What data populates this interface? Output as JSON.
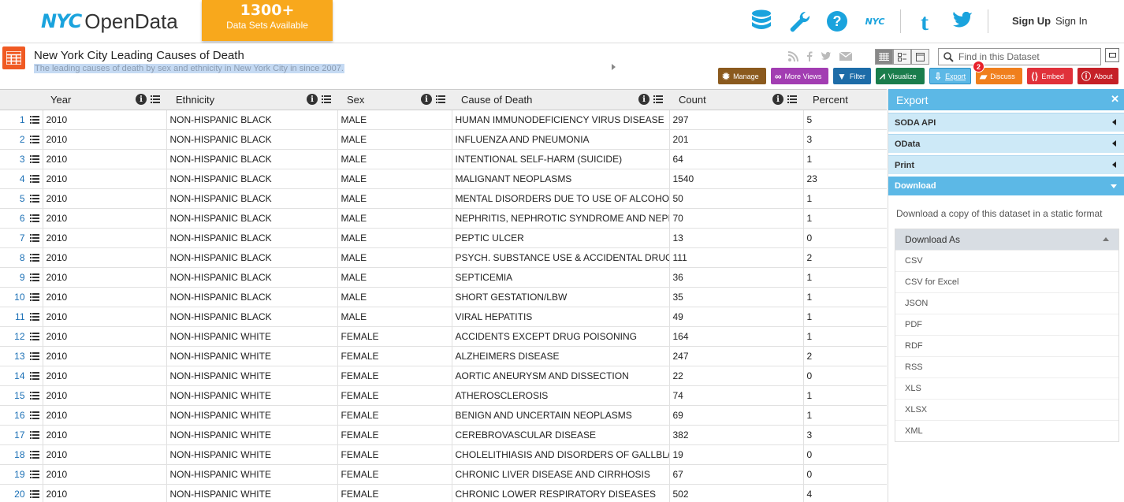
{
  "header": {
    "logo_nyc": "NYC",
    "logo_opendata": "OpenData",
    "promo_count": "1300+",
    "promo_text": "Data Sets Available",
    "sign_up": "Sign Up",
    "sign_in": "Sign In",
    "icons": [
      "database-icon",
      "wrench-icon",
      "help-icon",
      "nyc-icon",
      "tumblr-icon",
      "twitter-icon"
    ]
  },
  "dataset": {
    "title": "New York City Leading Causes of Death",
    "description": "The leading causes of death by sex and ethnicity in New York City in since 2007.",
    "find_placeholder": "Find in this Dataset"
  },
  "actions": {
    "manage": "Manage",
    "more_views": "More Views",
    "filter": "Filter",
    "visualize": "Visualize",
    "export": "Export",
    "discuss": "Discuss",
    "discuss_badge": "2",
    "embed": "Embed",
    "about": "About"
  },
  "table": {
    "columns": [
      "Year",
      "Ethnicity",
      "Sex",
      "Cause of Death",
      "Count",
      "Percent"
    ],
    "rows": [
      [
        "1",
        "2010",
        "NON-HISPANIC BLACK",
        "MALE",
        "HUMAN IMMUNODEFICIENCY VIRUS DISEASE",
        "297",
        "5"
      ],
      [
        "2",
        "2010",
        "NON-HISPANIC BLACK",
        "MALE",
        "INFLUENZA AND PNEUMONIA",
        "201",
        "3"
      ],
      [
        "3",
        "2010",
        "NON-HISPANIC BLACK",
        "MALE",
        "INTENTIONAL SELF-HARM (SUICIDE)",
        "64",
        "1"
      ],
      [
        "4",
        "2010",
        "NON-HISPANIC BLACK",
        "MALE",
        "MALIGNANT NEOPLASMS",
        "1540",
        "23"
      ],
      [
        "5",
        "2010",
        "NON-HISPANIC BLACK",
        "MALE",
        "MENTAL DISORDERS DUE TO USE OF ALCOHO",
        "50",
        "1"
      ],
      [
        "6",
        "2010",
        "NON-HISPANIC BLACK",
        "MALE",
        "NEPHRITIS, NEPHROTIC SYNDROME AND NEPI",
        "70",
        "1"
      ],
      [
        "7",
        "2010",
        "NON-HISPANIC BLACK",
        "MALE",
        "PEPTIC ULCER",
        "13",
        "0"
      ],
      [
        "8",
        "2010",
        "NON-HISPANIC BLACK",
        "MALE",
        "PSYCH. SUBSTANCE USE & ACCIDENTAL DRUC",
        "111",
        "2"
      ],
      [
        "9",
        "2010",
        "NON-HISPANIC BLACK",
        "MALE",
        "SEPTICEMIA",
        "36",
        "1"
      ],
      [
        "10",
        "2010",
        "NON-HISPANIC BLACK",
        "MALE",
        "SHORT GESTATION/LBW",
        "35",
        "1"
      ],
      [
        "11",
        "2010",
        "NON-HISPANIC BLACK",
        "MALE",
        "VIRAL HEPATITIS",
        "49",
        "1"
      ],
      [
        "12",
        "2010",
        "NON-HISPANIC WHITE",
        "FEMALE",
        "ACCIDENTS EXCEPT DRUG POISONING",
        "164",
        "1"
      ],
      [
        "13",
        "2010",
        "NON-HISPANIC WHITE",
        "FEMALE",
        "ALZHEIMERS DISEASE",
        "247",
        "2"
      ],
      [
        "14",
        "2010",
        "NON-HISPANIC WHITE",
        "FEMALE",
        "AORTIC ANEURYSM AND DISSECTION",
        "22",
        "0"
      ],
      [
        "15",
        "2010",
        "NON-HISPANIC WHITE",
        "FEMALE",
        "ATHEROSCLEROSIS",
        "74",
        "1"
      ],
      [
        "16",
        "2010",
        "NON-HISPANIC WHITE",
        "FEMALE",
        "BENIGN AND UNCERTAIN NEOPLASMS",
        "69",
        "1"
      ],
      [
        "17",
        "2010",
        "NON-HISPANIC WHITE",
        "FEMALE",
        "CEREBROVASCULAR DISEASE",
        "382",
        "3"
      ],
      [
        "18",
        "2010",
        "NON-HISPANIC WHITE",
        "FEMALE",
        "CHOLELITHIASIS AND DISORDERS OF GALLBL/",
        "19",
        "0"
      ],
      [
        "19",
        "2010",
        "NON-HISPANIC WHITE",
        "FEMALE",
        "CHRONIC LIVER DISEASE AND CIRRHOSIS",
        "67",
        "0"
      ],
      [
        "20",
        "2010",
        "NON-HISPANIC WHITE",
        "FEMALE",
        "CHRONIC LOWER RESPIRATORY DISEASES",
        "502",
        "4"
      ]
    ]
  },
  "sidebar": {
    "title": "Export",
    "sections": [
      "SODA API",
      "OData",
      "Print"
    ],
    "download_section": "Download",
    "download_desc": "Download a copy of this dataset in a static format",
    "download_as": "Download As",
    "formats": [
      "CSV",
      "CSV for Excel",
      "JSON",
      "PDF",
      "RDF",
      "RSS",
      "XLS",
      "XLSX",
      "XML"
    ]
  },
  "colors": {
    "accent": "#5cb8e6",
    "promo": "#f8a81c",
    "brand_blue": "#1aa3dd"
  }
}
